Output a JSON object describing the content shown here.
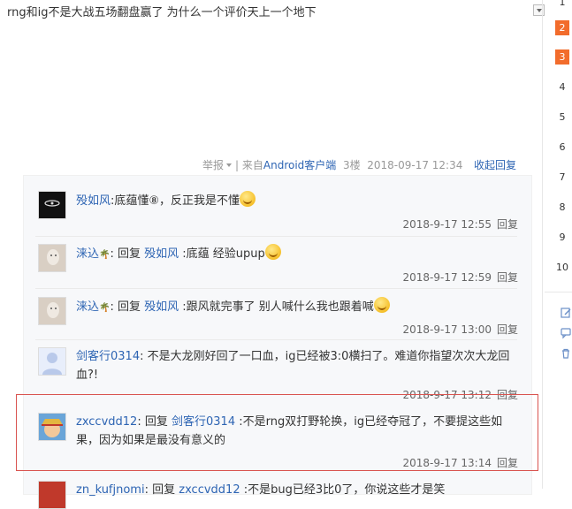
{
  "post": {
    "text": "rng和ig不是大战五场翻盘赢了 为什么一个评价天上一个地下",
    "meta": {
      "report": "举报",
      "separator": "|",
      "from_prefix": "来自",
      "client": "Android客户端",
      "floor": "3楼",
      "time": "2018-09-17 12:34"
    },
    "collapse_label": "收起回复"
  },
  "replies": [
    {
      "user": "殁如风",
      "text": ":底蕴懂⑧，反正我是不懂",
      "has_emoji": true,
      "time": "2018-9-17 12:55",
      "reply_label": "回复"
    },
    {
      "user": "涞込",
      "reply_word": "回复",
      "target": "殁如风",
      "text": ":底蕴 经验upup",
      "has_emoji": true,
      "time": "2018-9-17 12:59",
      "reply_label": "回复"
    },
    {
      "user": "涞込",
      "reply_word": "回复",
      "target": "殁如风",
      "text": ":跟风就完事了 别人喊什么我也跟着喊",
      "has_emoji": true,
      "time": "2018-9-17 13:00",
      "reply_label": "回复"
    },
    {
      "user": "剑客行0314",
      "text": ": 不是大龙刚好回了一口血，ig已经被3:0横扫了。难道你指望次次大龙回血?!",
      "time": "2018-9-17 13:12",
      "reply_label": "回复"
    },
    {
      "user": "zxccvdd12",
      "reply_word": "回复",
      "target": "剑客行0314",
      "text": ":不是rng双打野轮换，ig已经夺冠了，不要提这些如果，因为如果是最没有意义的",
      "time": "2018-9-17 13:14",
      "reply_label": "回复"
    },
    {
      "user": "zn_kufjnomi",
      "reply_word": "回复",
      "target": "zxccvdd12",
      "text": ":不是bug已经3比0了，你说这些才是笑",
      "partial": true
    }
  ],
  "pager": [
    "1",
    "2",
    "3",
    "4",
    "5",
    "6",
    "7",
    "8",
    "9",
    "10"
  ],
  "pager_active": [
    "2",
    "3"
  ],
  "side_icons": [
    "edit-icon",
    "comment-icon",
    "trash-icon"
  ],
  "colors": {
    "link": "#2d64b3",
    "pager_active": "#f26c2c",
    "highlight": "#d9534f",
    "reply_bg": "#f7f8fa"
  }
}
